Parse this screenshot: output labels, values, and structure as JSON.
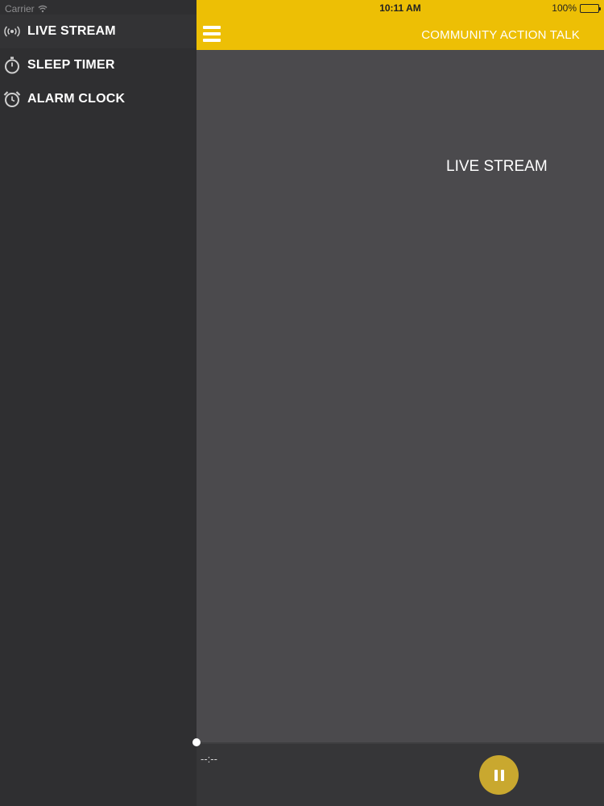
{
  "status_bar": {
    "carrier": "Carrier",
    "time": "10:11 AM",
    "battery": "100%",
    "battery_level": 1.0
  },
  "sidebar": {
    "items": [
      {
        "label": "LIVE STREAM",
        "icon": "broadcast-icon",
        "active": true
      },
      {
        "label": "SLEEP TIMER",
        "icon": "stopwatch-icon",
        "active": false
      },
      {
        "label": "ALARM CLOCK",
        "icon": "alarm-clock-icon",
        "active": false
      }
    ]
  },
  "header": {
    "title": "COMMUNITY ACTION TALK",
    "menu_icon": "hamburger-menu-icon"
  },
  "main": {
    "label": "LIVE STREAM"
  },
  "player": {
    "time": "--:--",
    "progress": 0,
    "button_icon": "pause-icon"
  },
  "colors": {
    "accent": "#edbf05",
    "sidebar_bg": "#2f2f31",
    "content_bg": "#4b4a4d",
    "player_bg": "#363638",
    "pause_button": "#c9a82f"
  }
}
